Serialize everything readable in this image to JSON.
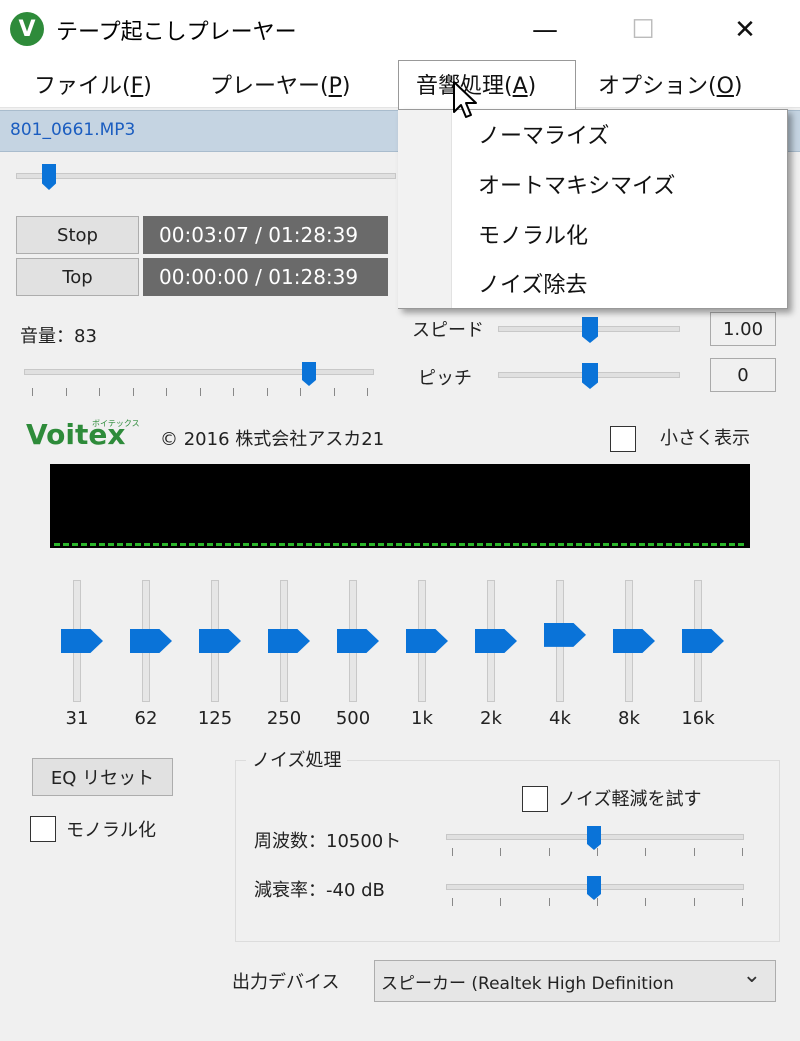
{
  "window": {
    "title": "テープ起こしプレーヤー",
    "icon_letter": "V",
    "minimize_glyph": "—",
    "maximize_glyph": "☐",
    "close_glyph": "✕"
  },
  "menu": {
    "file": {
      "text": "ファイル(",
      "key": "F",
      "end": ")"
    },
    "player": {
      "text": "プレーヤー(",
      "key": "P",
      "end": ")"
    },
    "audio": {
      "text": "音響処理(",
      "key": "A",
      "end": ")"
    },
    "options": {
      "text": "オプション(",
      "key": "O",
      "end": ")"
    }
  },
  "dropdown": {
    "items": [
      "ノーマライズ",
      "オートマキシマイズ",
      "モノラル化",
      "ノイズ除去"
    ]
  },
  "file": {
    "name": "801_0661.MP3"
  },
  "seek": {
    "position_fraction": 0.05
  },
  "transport": {
    "stop_label": "Stop",
    "top_label": "Top",
    "time_position": "00:03:07 / 01:28:39",
    "time_start": "00:00:00 / 01:28:39"
  },
  "volume": {
    "label": "音量：83",
    "value": 83
  },
  "speed": {
    "label": "スピード",
    "value": "1.00",
    "fraction": 0.5
  },
  "pitch": {
    "label": "ピッチ",
    "value": "0",
    "fraction": 0.5
  },
  "brand": {
    "logo": "Voitex",
    "logo_ruby": "ボイテックス",
    "copyright": "© 2016 株式会社アスカ21"
  },
  "small_view": {
    "label": "小さく表示"
  },
  "eq": {
    "bands": [
      "31",
      "62",
      "125",
      "250",
      "500",
      "1k",
      "2k",
      "4k",
      "8k",
      "16k"
    ],
    "levels": [
      0,
      0,
      0,
      0,
      0,
      0,
      0,
      0.1,
      0,
      0
    ],
    "reset_label": "EQ リセット"
  },
  "mono": {
    "label": "モノラル化"
  },
  "noise": {
    "group_title": "ノイズ処理",
    "try_label": "ノイズ軽減を試す",
    "freq_label": "周波数：10500ト",
    "freq_fraction": 0.5,
    "atten_label": "減衰率：-40 dB",
    "atten_fraction": 0.5
  },
  "output": {
    "label": "出力デバイス",
    "device": "スピーカー (Realtek High Definition",
    "chevron": "⌄"
  },
  "colors": {
    "accent": "#0a73d8",
    "logo_green": "#2e8b3a",
    "file_strip": "#c5d4e2",
    "spectrum_bar": "#2bb52b"
  }
}
